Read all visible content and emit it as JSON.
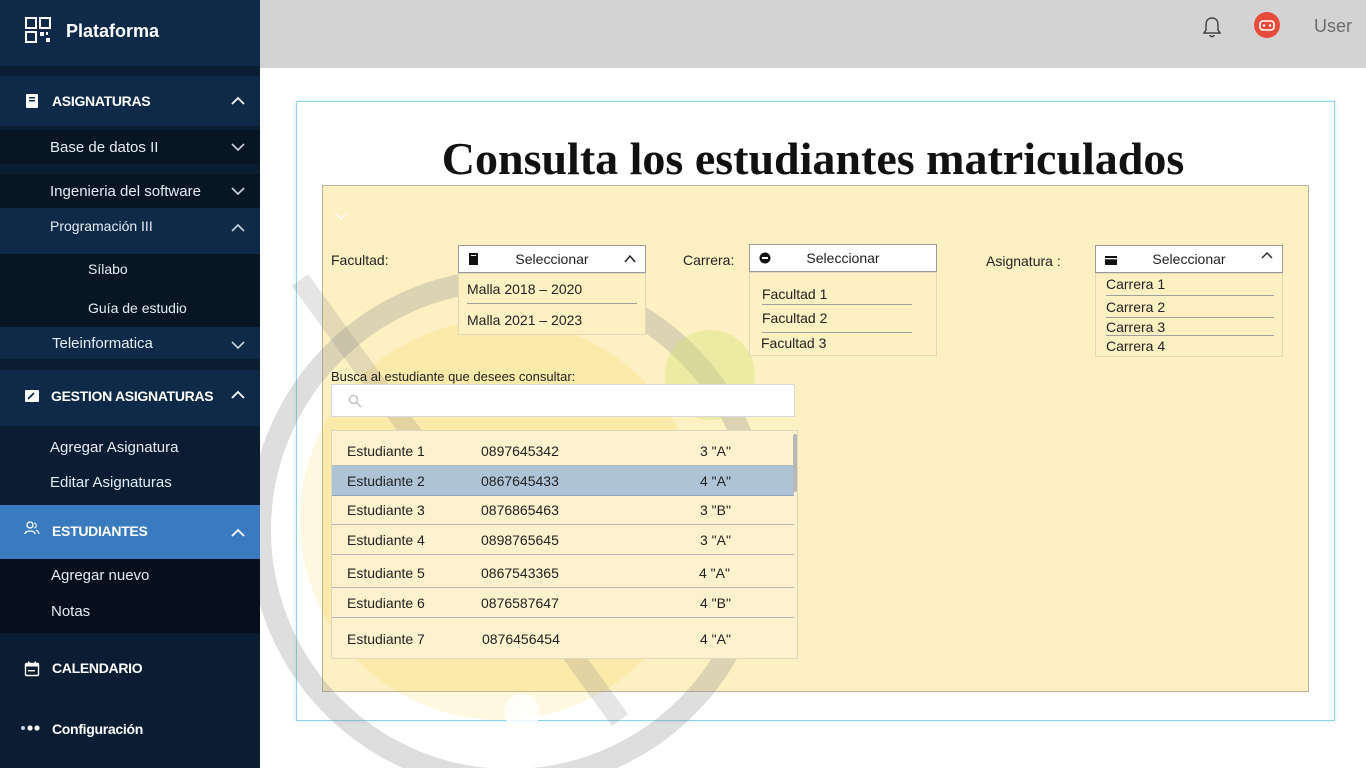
{
  "brand": {
    "name": "Plataforma",
    "icon": "qr-grid-icon"
  },
  "sidebar": {
    "asignaturas": {
      "label": "ASIGNATURAS",
      "icon": "book-icon",
      "items": [
        {
          "label": "Base de datos II"
        },
        {
          "label": "Ingenieria del software"
        },
        {
          "label": "Programación III",
          "children": [
            {
              "label": "Sílabo"
            },
            {
              "label": "Guía de estudio"
            }
          ]
        },
        {
          "label": "Teleinformatica"
        }
      ]
    },
    "gestion": {
      "label": "GESTION ASIGNATURAS",
      "icon": "edit-board-icon",
      "items": [
        {
          "label": "Agregar Asignatura"
        },
        {
          "label": "Editar Asignaturas"
        }
      ]
    },
    "estudiantes": {
      "label": "ESTUDIANTES",
      "icon": "users-icon",
      "items": [
        {
          "label": "Agregar nuevo"
        },
        {
          "label": "Notas"
        }
      ]
    },
    "calendario": {
      "label": "CALENDARIO",
      "icon": "calendar-icon"
    },
    "configuracion": {
      "label": "Configuración",
      "icon": "dots-icon"
    }
  },
  "topbar": {
    "user": "User",
    "bell_icon": "bell-icon",
    "avatar_icon": "robot-avatar-icon"
  },
  "main": {
    "title": "Consulta los estudiantes matriculados",
    "filters": {
      "facultad": {
        "label": "Facultad:",
        "placeholder": "Seleccionar",
        "options": [
          "Malla 2018 – 2020",
          "Malla 2021 – 2023"
        ]
      },
      "carrera": {
        "label": "Carrera:",
        "placeholder": "Seleccionar",
        "options": [
          "Facultad 1",
          "Facultad 2",
          "Facultad 3"
        ]
      },
      "asignatura": {
        "label": "Asignatura :",
        "placeholder": "Seleccionar",
        "options": [
          "Carrera 1",
          "Carrera 2",
          "Carrera 3",
          "Carrera 4"
        ]
      }
    },
    "search": {
      "label": "Busca al estudiante que desees consultar:",
      "placeholder": ""
    },
    "students": [
      {
        "name": "Estudiante 1",
        "id": "0897645342",
        "grade": "3 \"A\""
      },
      {
        "name": "Estudiante 2",
        "id": "0867645433",
        "grade": "4 \"A\""
      },
      {
        "name": "Estudiante 3",
        "id": "0876865463",
        "grade": "3 \"B\""
      },
      {
        "name": "Estudiante 4",
        "id": "0898765645",
        "grade": "3 \"A\""
      },
      {
        "name": "Estudiante 5",
        "id": "0867543365",
        "grade": "4 \"A\""
      },
      {
        "name": "Estudiante 6",
        "id": "0876587647",
        "grade": "4 \"B\""
      },
      {
        "name": "Estudiante 7",
        "id": "0876456454",
        "grade": "4 \"A\""
      }
    ],
    "selected_student_index": 1
  },
  "colors": {
    "sidebar_bg": "#0b1d33",
    "sidebar_active": "#3a7bbf",
    "panel_bg": "#fdf0c2",
    "selected_row": "#aec4d6",
    "avatar": "#e74c3c"
  }
}
